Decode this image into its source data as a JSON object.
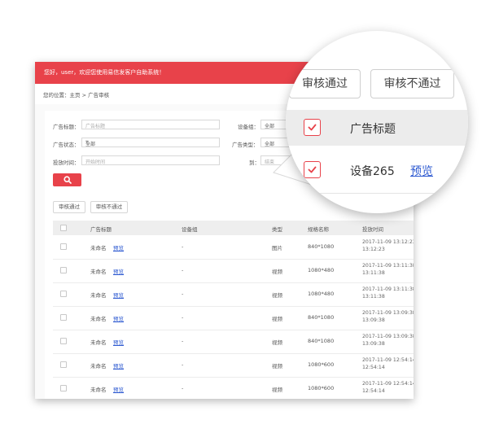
{
  "header": {
    "greeting": "您好，user，欢迎您使用易信发客户自助系统！"
  },
  "breadcrumb": {
    "text": "您的位置：主页 > 广告审核"
  },
  "filters": {
    "title_label": "广告标题：",
    "title_placeholder": "广告标题",
    "device_group_label": "设备组：",
    "device_group_value": "全部",
    "status_label": "广告状态：",
    "status_value": "全部",
    "type_label": "广告类型：",
    "type_value": "全部",
    "time_label": "投放时间：",
    "start_placeholder": "开始时间",
    "to_label": "到：",
    "end_placeholder": "结束"
  },
  "actions": {
    "approve": "审核通过",
    "reject": "审核不通过"
  },
  "table": {
    "headers": [
      "广告标题",
      "设备组",
      "类型",
      "规格名称",
      "投放时间"
    ],
    "preview_label": "预览",
    "rows": [
      {
        "title": "未命名",
        "group": "-",
        "type": "图片",
        "spec": "840*1080",
        "time1": "2017-11-09 13:12:23 至",
        "time2": "13:12:23"
      },
      {
        "title": "未命名",
        "group": "-",
        "type": "视频",
        "spec": "1080*480",
        "time1": "2017-11-09 13:11:38 至",
        "time2": "13:11:38"
      },
      {
        "title": "未命名",
        "group": "-",
        "type": "视频",
        "spec": "1080*480",
        "time1": "2017-11-09 13:11:38 至",
        "time2": "13:11:38"
      },
      {
        "title": "未命名",
        "group": "-",
        "type": "视频",
        "spec": "840*1080",
        "time1": "2017-11-09 13:09:38 至",
        "time2": "13:09:38"
      },
      {
        "title": "未命名",
        "group": "-",
        "type": "视频",
        "spec": "840*1080",
        "time1": "2017-11-09 13:09:38 至",
        "time2": "13:09:38"
      },
      {
        "title": "未命名",
        "group": "-",
        "type": "视频",
        "spec": "1080*600",
        "time1": "2017-11-09 12:54:14 至",
        "time2": "12:54:14"
      },
      {
        "title": "未命名",
        "group": "-",
        "type": "视频",
        "spec": "1080*600",
        "time1": "2017-11-09 12:54:14 至",
        "time2": "12:54:14"
      }
    ]
  },
  "magnifier": {
    "approve": "审核通过",
    "reject": "审核不通过",
    "header_title": "广告标题",
    "row_title": "设备265",
    "row_preview": "预览"
  },
  "colors": {
    "accent": "#e8424a",
    "link": "#2f5bd1"
  }
}
